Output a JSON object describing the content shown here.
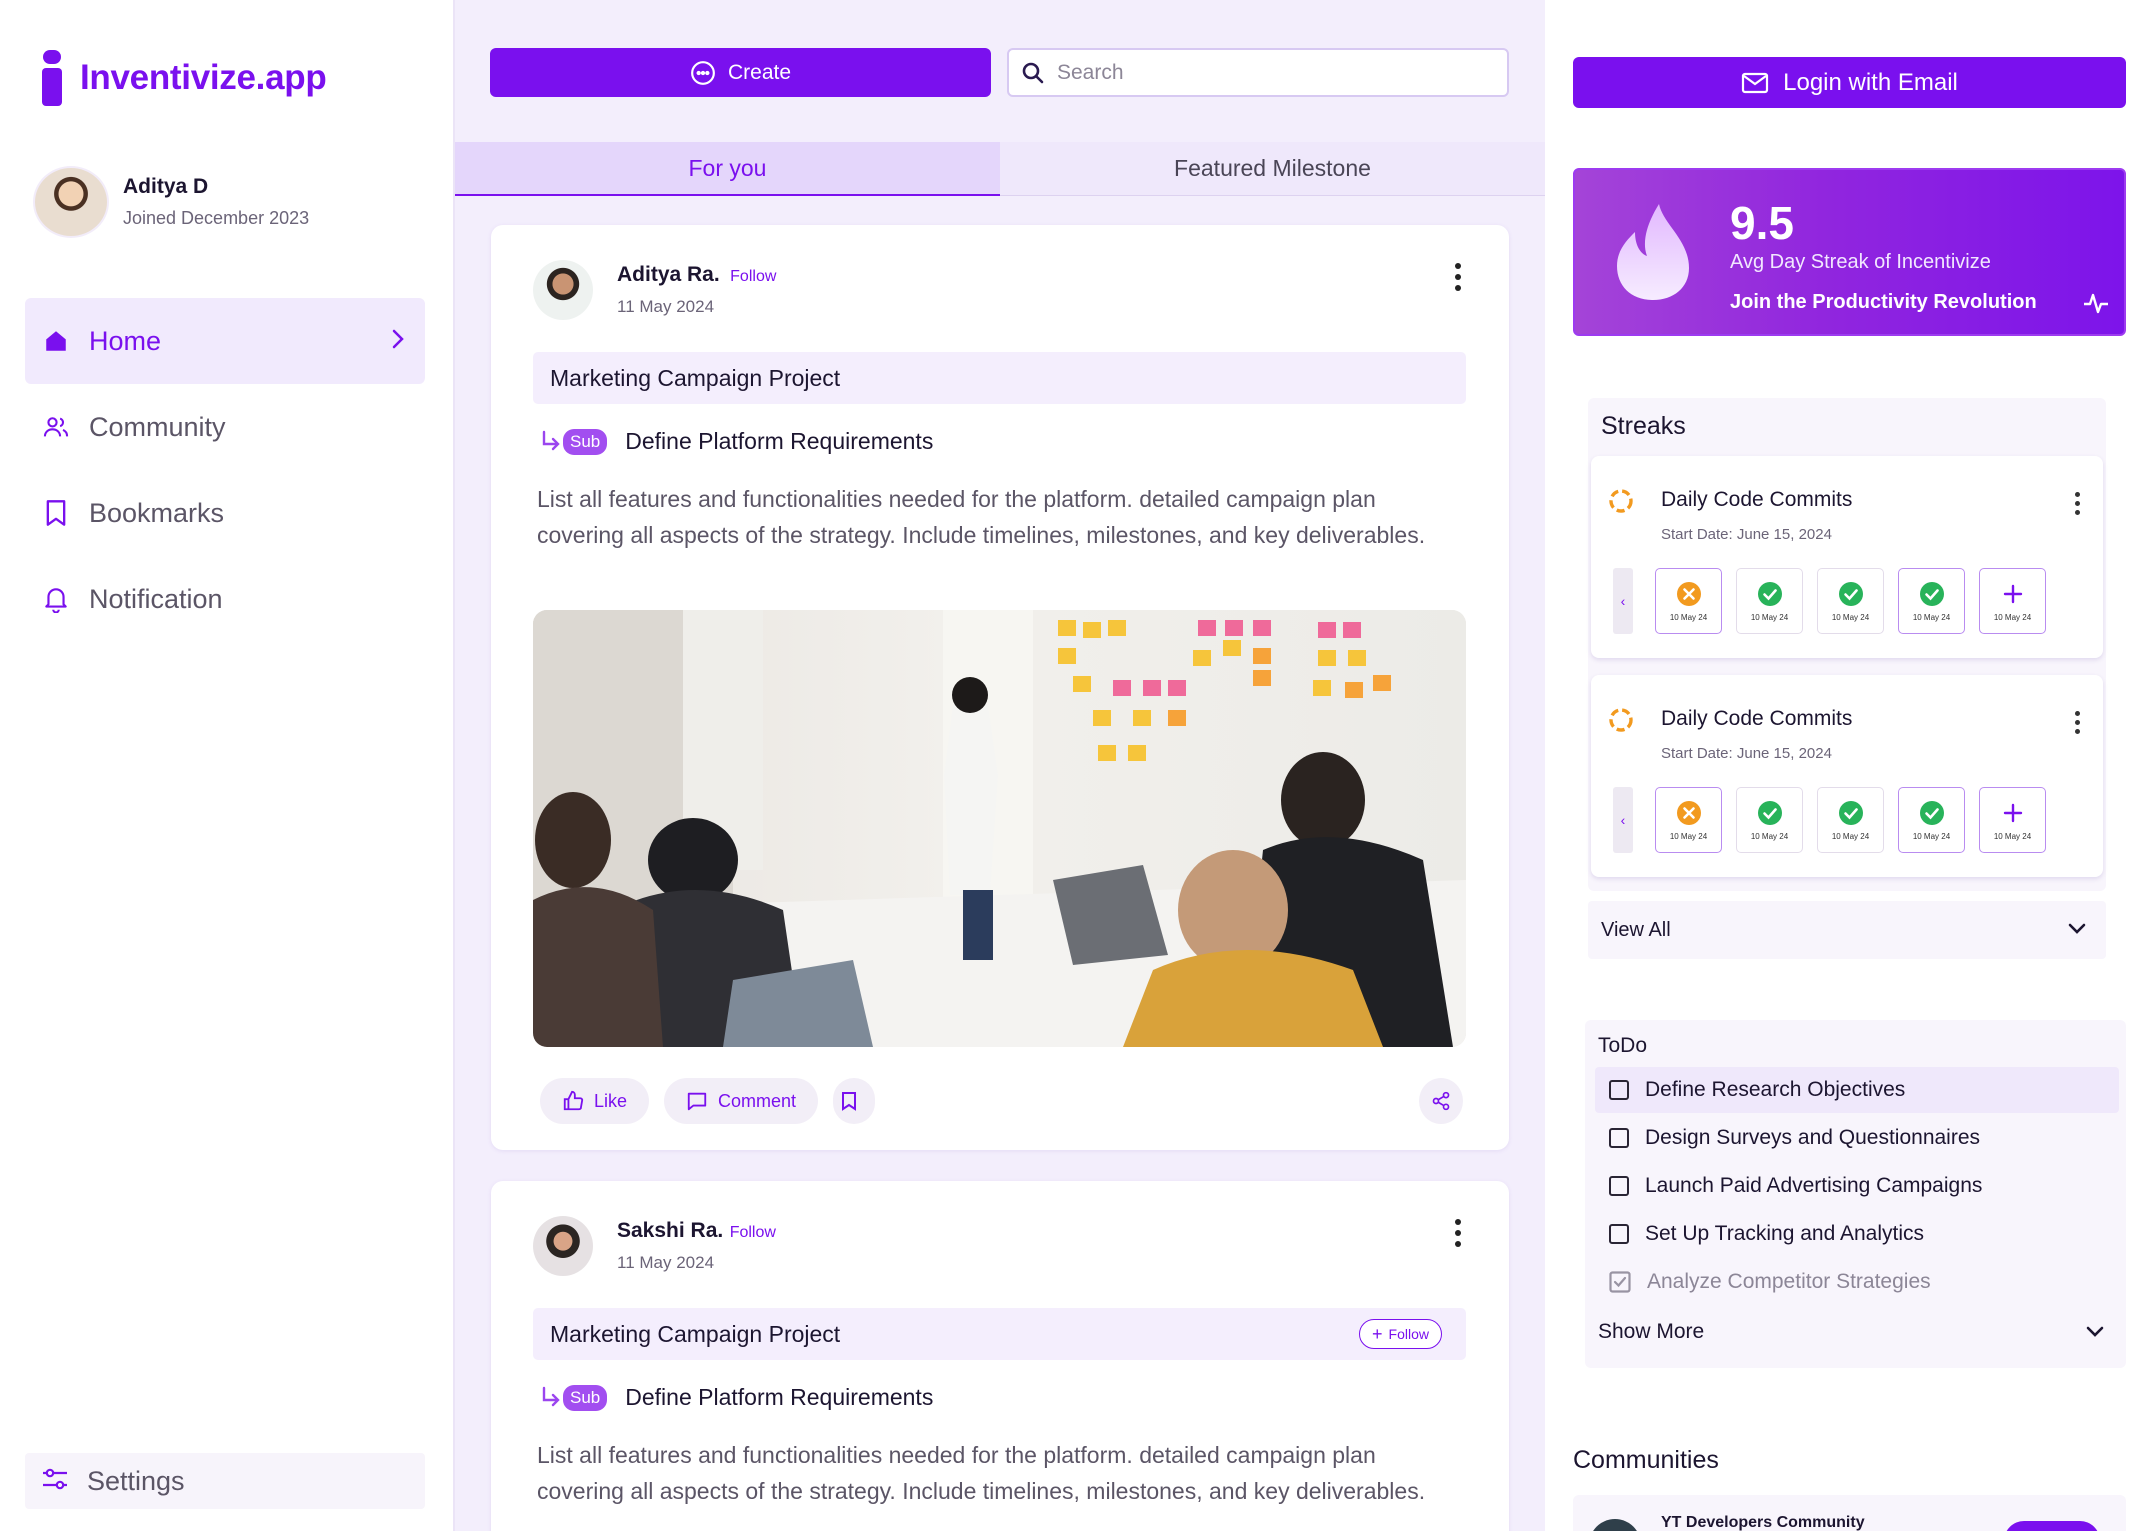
{
  "brand": {
    "name": "Inventivize.app",
    "color": "#7a10ee"
  },
  "user": {
    "name": "Aditya D",
    "joined": "Joined December 2023"
  },
  "nav": {
    "items": [
      {
        "label": "Home",
        "icon": "home-icon",
        "active": true
      },
      {
        "label": "Community",
        "icon": "users-icon"
      },
      {
        "label": "Bookmarks",
        "icon": "bookmark-icon"
      },
      {
        "label": "Notification",
        "icon": "bell-icon"
      }
    ],
    "settings": "Settings"
  },
  "topbar": {
    "create_label": "Create",
    "search_placeholder": "Search"
  },
  "tabs": [
    {
      "label": "For you",
      "active": true
    },
    {
      "label": "Featured Milestone"
    }
  ],
  "posts": [
    {
      "author": "Aditya Ra.",
      "follow": "Follow",
      "date": "11 May 2024",
      "project": "Marketing Campaign Project",
      "sub_badge": "Sub",
      "sub_title": "Define Platform Requirements",
      "description": "List all features and functionalities needed for the platform. detailed campaign plan covering all aspects of the strategy. Include timelines, milestones, and key deliverables.",
      "like_label": "Like",
      "comment_label": "Comment"
    },
    {
      "author": "Sakshi Ra.",
      "follow": "Follow",
      "date": "11 May 2024",
      "project": "Marketing Campaign Project",
      "project_follow": "Follow",
      "sub_badge": "Sub",
      "sub_title": "Define Platform Requirements",
      "description": "List all features and functionalities needed for the platform. detailed campaign plan covering all aspects of the strategy. Include timelines, milestones, and key deliverables."
    }
  ],
  "right": {
    "login_label": "Login with Email",
    "promo": {
      "value": "9.5",
      "subtitle": "Avg Day Streak of Incentivize",
      "cta": "Join the Productivity Revolution"
    },
    "streaks": {
      "title": "Streaks",
      "cards": [
        {
          "title": "Daily Code Commits",
          "start": "Start Date: June 15, 2024",
          "days": [
            {
              "status": "missed",
              "label": "10 May 24"
            },
            {
              "status": "done",
              "label": "10 May 24"
            },
            {
              "status": "done",
              "label": "10 May 24"
            },
            {
              "status": "done",
              "label": "10 May 24"
            },
            {
              "status": "add",
              "label": "10 May 24"
            }
          ]
        },
        {
          "title": "Daily Code Commits",
          "start": "Start Date: June 15, 2024",
          "days": [
            {
              "status": "missed",
              "label": "10 May 24"
            },
            {
              "status": "done",
              "label": "10 May 24"
            },
            {
              "status": "done",
              "label": "10 May 24"
            },
            {
              "status": "done",
              "label": "10 May 24"
            },
            {
              "status": "add",
              "label": "10 May 24"
            }
          ]
        }
      ],
      "view_all": "View All"
    },
    "todo": {
      "title": "ToDo",
      "items": [
        {
          "label": "Define Research Objectives",
          "done": false
        },
        {
          "label": "Design Surveys and Questionnaires",
          "done": false
        },
        {
          "label": "Launch Paid Advertising Campaigns",
          "done": false
        },
        {
          "label": "Set Up Tracking and Analytics",
          "done": false
        },
        {
          "label": "Analyze Competitor Strategies",
          "done": true
        }
      ],
      "show_more": "Show More"
    },
    "communities": {
      "title": "Communities",
      "first": "YT Developers Community"
    }
  },
  "colors": {
    "accent": "#7a10ee",
    "missed": "#f29a1f",
    "done": "#28b35a"
  }
}
